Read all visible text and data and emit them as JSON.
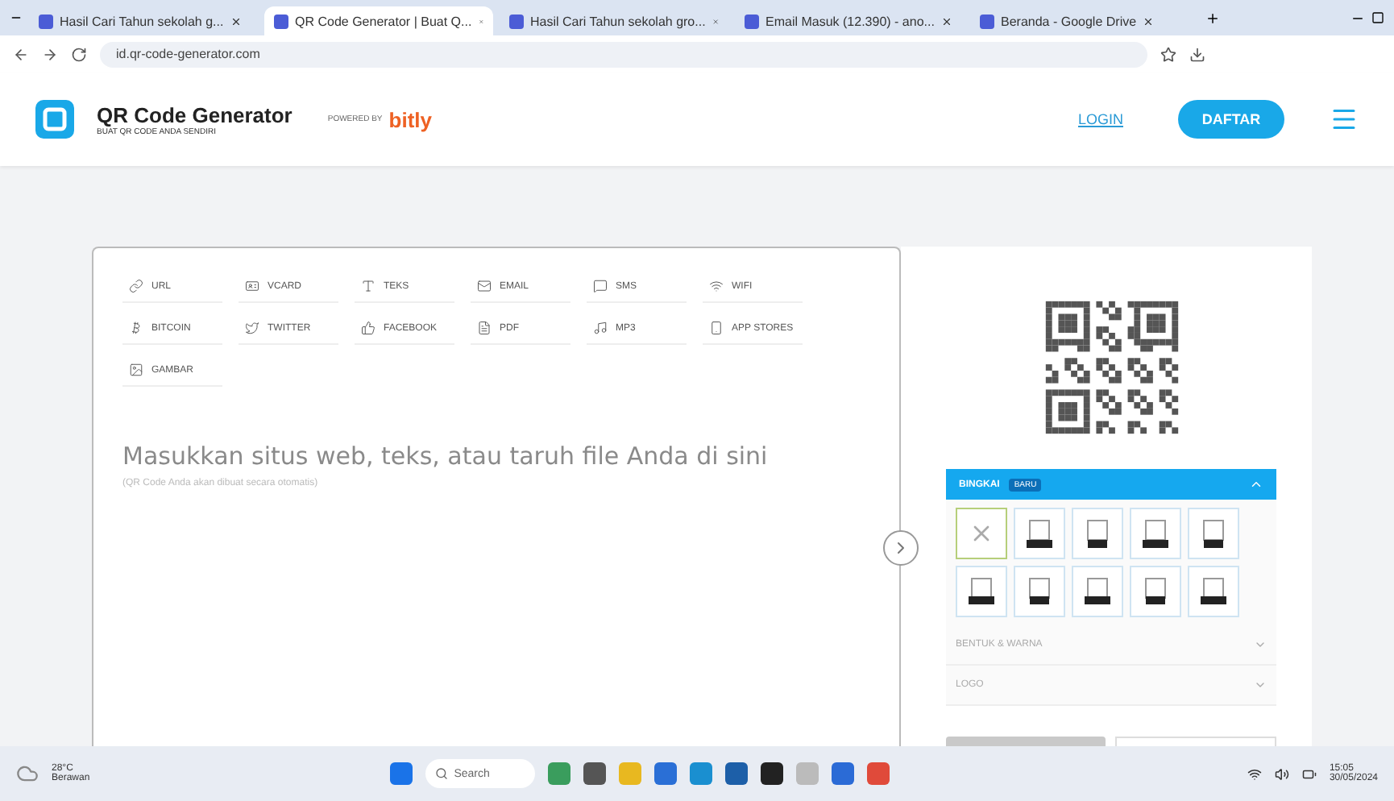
{
  "browser": {
    "tabs": [
      {
        "title": "Hasil Cari Tahun sekolah g...",
        "selected": false
      },
      {
        "title": "QR Code Generator | Buat Q...",
        "selected": true
      },
      {
        "title": "Hasil Cari Tahun sekolah gro...",
        "selected": false
      },
      {
        "title": "Email Masuk (12.390) - ano...",
        "selected": false
      },
      {
        "title": "Beranda - Google Drive",
        "selected": false
      }
    ],
    "address": "id.qr-code-generator.com"
  },
  "header": {
    "brand": "QR Code Generator",
    "tagline": "BUAT QR CODE ANDA SENDIRI",
    "powered_by": "POWERED BY",
    "partner": "bitly",
    "login": "LOGIN",
    "signup": "DAFTAR"
  },
  "types": [
    {
      "label": "URL",
      "selected": false
    },
    {
      "label": "VCARD",
      "selected": false
    },
    {
      "label": "TEKS",
      "selected": false
    },
    {
      "label": "EMAIL",
      "selected": false
    },
    {
      "label": "SMS",
      "selected": false
    },
    {
      "label": "WIFI",
      "selected": false
    },
    {
      "label": "BITCOIN",
      "selected": false
    },
    {
      "label": "TWITTER",
      "selected": false
    },
    {
      "label": "FACEBOOK",
      "selected": false
    },
    {
      "label": "PDF",
      "selected": false
    },
    {
      "label": "MP3",
      "selected": false
    },
    {
      "label": "APP STORES",
      "selected": false
    },
    {
      "label": "GAMBAR",
      "selected": false
    }
  ],
  "input": {
    "placeholder": "Masukkan situs web, teks, atau taruh file Anda di sini",
    "hint": "(QR Code Anda akan dibuat secara otomatis)"
  },
  "panel": {
    "frame_section": {
      "title": "BINGKAI",
      "badge": "BARU",
      "expanded": true
    },
    "frames": [
      {
        "selected": true
      },
      {
        "selected": false
      },
      {
        "selected": false
      },
      {
        "selected": false
      },
      {
        "selected": false
      },
      {
        "selected": false
      },
      {
        "selected": false
      },
      {
        "selected": false
      },
      {
        "selected": false
      },
      {
        "selected": false
      }
    ],
    "sections": [
      {
        "title": "BENTUK & WARNA",
        "expanded": false
      },
      {
        "title": "LOGO",
        "expanded": false
      }
    ]
  },
  "taskbar": {
    "weather": "28°C",
    "weather_desc": "Berawan",
    "search": "Search",
    "time": "15:05",
    "date": "30/05/2024"
  }
}
